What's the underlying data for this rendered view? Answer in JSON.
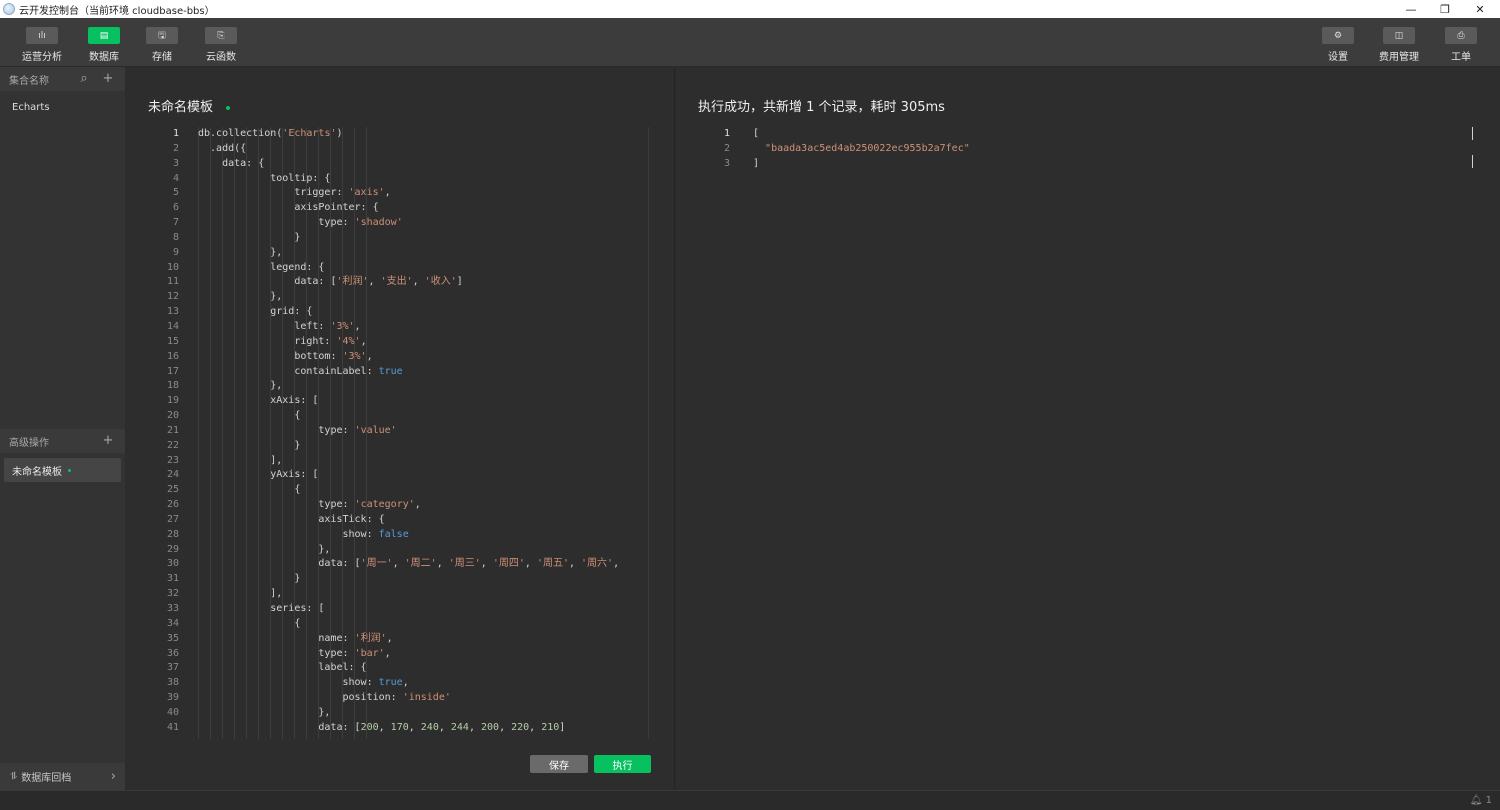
{
  "window": {
    "title": "云开发控制台（当前环境 cloudbase-bbs）",
    "controls": [
      "—",
      "❐",
      "✕"
    ]
  },
  "toolbar": {
    "left": [
      {
        "label": "运营分析",
        "icon": "bar-chart-icon",
        "glyph": "ılı",
        "active": false
      },
      {
        "label": "数据库",
        "icon": "database-icon",
        "glyph": "▤",
        "active": true
      },
      {
        "label": "存储",
        "icon": "storage-icon",
        "glyph": "🖫",
        "active": false
      },
      {
        "label": "云函数",
        "icon": "function-icon",
        "glyph": "⎘",
        "active": false
      }
    ],
    "right": [
      {
        "label": "设置",
        "icon": "gear-icon",
        "glyph": "⚙"
      },
      {
        "label": "费用管理",
        "icon": "billing-icon",
        "glyph": "◫"
      },
      {
        "label": "工单",
        "icon": "ticket-icon",
        "glyph": "⎙"
      }
    ]
  },
  "sidebar": {
    "collections_header": "集合名称",
    "search_glyph": "⌕",
    "add_glyph": "+",
    "collections": [
      "Echarts"
    ],
    "advanced_header": "高级操作",
    "templates": [
      {
        "label": "未命名模板",
        "unsaved": true
      }
    ],
    "rollback_label": "数据库回档",
    "rollback_glyph": "⥮",
    "chevron_glyph": "›"
  },
  "editor": {
    "title": "未命名模板",
    "current_line": 1,
    "save_label": "保存",
    "run_label": "执行",
    "lines": [
      [
        [
          "",
          "db.collection("
        ],
        [
          "s",
          "'Echarts'"
        ],
        [
          "",
          ")"
        ]
      ],
      [
        [
          "",
          "  .add({"
        ]
      ],
      [
        [
          "",
          "    data: {"
        ]
      ],
      [
        [
          "",
          "            tooltip: {"
        ]
      ],
      [
        [
          "",
          "                trigger: "
        ],
        [
          "s",
          "'axis'"
        ],
        [
          "",
          ","
        ]
      ],
      [
        [
          "",
          "                axisPointer: {"
        ]
      ],
      [
        [
          "",
          "                    type: "
        ],
        [
          "s",
          "'shadow'"
        ]
      ],
      [
        [
          "",
          "                }"
        ]
      ],
      [
        [
          "",
          "            },"
        ]
      ],
      [
        [
          "",
          "            legend: {"
        ]
      ],
      [
        [
          "",
          "                data: ["
        ],
        [
          "s",
          "'利润'"
        ],
        [
          "",
          ", "
        ],
        [
          "s",
          "'支出'"
        ],
        [
          "",
          ", "
        ],
        [
          "s",
          "'收入'"
        ],
        [
          "",
          "]"
        ]
      ],
      [
        [
          "",
          "            },"
        ]
      ],
      [
        [
          "",
          "            grid: {"
        ]
      ],
      [
        [
          "",
          "                left: "
        ],
        [
          "s",
          "'3%'"
        ],
        [
          "",
          ","
        ]
      ],
      [
        [
          "",
          "                right: "
        ],
        [
          "s",
          "'4%'"
        ],
        [
          "",
          ","
        ]
      ],
      [
        [
          "",
          "                bottom: "
        ],
        [
          "s",
          "'3%'"
        ],
        [
          "",
          ","
        ]
      ],
      [
        [
          "",
          "                containLabel: "
        ],
        [
          "k",
          "true"
        ]
      ],
      [
        [
          "",
          "            },"
        ]
      ],
      [
        [
          "",
          "            xAxis: ["
        ]
      ],
      [
        [
          "",
          "                {"
        ]
      ],
      [
        [
          "",
          "                    type: "
        ],
        [
          "s",
          "'value'"
        ]
      ],
      [
        [
          "",
          "                }"
        ]
      ],
      [
        [
          "",
          "            ],"
        ]
      ],
      [
        [
          "",
          "            yAxis: ["
        ]
      ],
      [
        [
          "",
          "                {"
        ]
      ],
      [
        [
          "",
          "                    type: "
        ],
        [
          "s",
          "'category'"
        ],
        [
          "",
          ","
        ]
      ],
      [
        [
          "",
          "                    axisTick: {"
        ]
      ],
      [
        [
          "",
          "                        show: "
        ],
        [
          "k",
          "false"
        ]
      ],
      [
        [
          "",
          "                    },"
        ]
      ],
      [
        [
          "",
          "                    data: ["
        ],
        [
          "s",
          "'周一'"
        ],
        [
          "",
          ", "
        ],
        [
          "s",
          "'周二'"
        ],
        [
          "",
          ", "
        ],
        [
          "s",
          "'周三'"
        ],
        [
          "",
          ", "
        ],
        [
          "s",
          "'周四'"
        ],
        [
          "",
          ", "
        ],
        [
          "s",
          "'周五'"
        ],
        [
          "",
          ", "
        ],
        [
          "s",
          "'周六'"
        ],
        [
          "",
          ","
        ]
      ],
      [
        [
          "",
          "                }"
        ]
      ],
      [
        [
          "",
          "            ],"
        ]
      ],
      [
        [
          "",
          "            series: ["
        ]
      ],
      [
        [
          "",
          "                {"
        ]
      ],
      [
        [
          "",
          "                    name: "
        ],
        [
          "s",
          "'利润'"
        ],
        [
          "",
          ","
        ]
      ],
      [
        [
          "",
          "                    type: "
        ],
        [
          "s",
          "'bar'"
        ],
        [
          "",
          ","
        ]
      ],
      [
        [
          "",
          "                    label: {"
        ]
      ],
      [
        [
          "",
          "                        show: "
        ],
        [
          "k",
          "true"
        ],
        [
          "",
          ","
        ]
      ],
      [
        [
          "",
          "                        position: "
        ],
        [
          "s",
          "'inside'"
        ]
      ],
      [
        [
          "",
          "                    },"
        ]
      ],
      [
        [
          "",
          "                    data: ["
        ],
        [
          "n",
          "200"
        ],
        [
          "",
          ", "
        ],
        [
          "n",
          "170"
        ],
        [
          "",
          ", "
        ],
        [
          "n",
          "240"
        ],
        [
          "",
          ", "
        ],
        [
          "n",
          "244"
        ],
        [
          "",
          ", "
        ],
        [
          "n",
          "200"
        ],
        [
          "",
          ", "
        ],
        [
          "n",
          "220"
        ],
        [
          "",
          ", "
        ],
        [
          "n",
          "210"
        ],
        [
          "",
          "]"
        ]
      ]
    ]
  },
  "result": {
    "title": "执行成功，共新增 1 个记录，耗时 305ms",
    "current_line": 1,
    "lines": [
      [
        [
          "",
          "["
        ]
      ],
      [
        [
          "",
          "  "
        ],
        [
          "s",
          "\"baada3ac5ed4ab250022ec955b2a7fec\""
        ]
      ],
      [
        [
          "",
          "]"
        ]
      ]
    ]
  },
  "statusbar": {
    "bell_glyph": "🔔︎",
    "notification_count": "1"
  }
}
